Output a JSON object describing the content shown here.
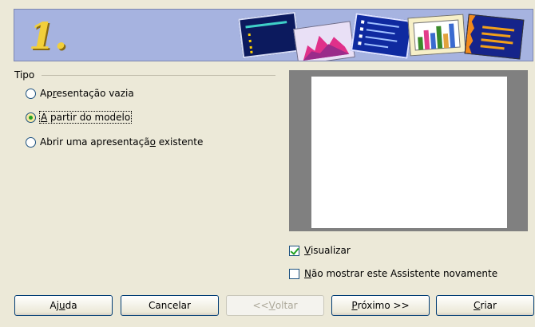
{
  "banner": {
    "step": "1."
  },
  "tipo": {
    "label": "Tipo",
    "options": [
      {
        "pre": "Ap",
        "u": "r",
        "post": "esentação vazia",
        "checked": false
      },
      {
        "pre": "",
        "u": "A",
        "post": " partir do modelo",
        "checked": true
      },
      {
        "pre": "Abrir uma apresentaçã",
        "u": "o",
        "post": " existente",
        "checked": false
      }
    ]
  },
  "preview": {
    "visualizar": {
      "pre": "",
      "u": "V",
      "post": "isualizar",
      "checked": true
    },
    "nao_mostrar": {
      "pre": "",
      "u": "N",
      "post": "ão mostrar este Assistente novamente",
      "checked": false
    }
  },
  "buttons": {
    "ajuda": {
      "pre": "Aj",
      "u": "u",
      "post": "da"
    },
    "cancelar": {
      "pre": "Cancelar",
      "u": "",
      "post": ""
    },
    "voltar": {
      "pre": "<< ",
      "u": "V",
      "post": "oltar"
    },
    "proximo": {
      "pre": "",
      "u": "P",
      "post": "róximo >>"
    },
    "criar": {
      "pre": "",
      "u": "C",
      "post": "riar"
    }
  }
}
